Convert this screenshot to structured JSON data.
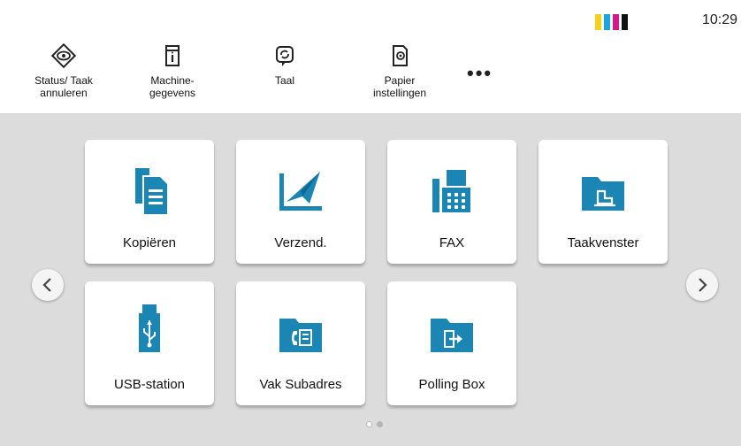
{
  "header": {
    "clock": "10:29",
    "toner_colors": [
      "#f2d21b",
      "#1aa6e0",
      "#d6198a",
      "#111111"
    ]
  },
  "quick_menu": {
    "items": [
      {
        "label": "Status/ Taak\nannuleren",
        "icon": "eye-diamond-icon"
      },
      {
        "label": "Machine-\ngegevens",
        "icon": "device-info-icon"
      },
      {
        "label": "Taal",
        "icon": "language-icon"
      },
      {
        "label": "Papier\ninstellingen",
        "icon": "paper-settings-icon"
      }
    ],
    "more_label": "•••"
  },
  "home": {
    "accent_color": "#1b86b4",
    "tiles": [
      {
        "label": "Kopiëren",
        "icon": "copy-icon"
      },
      {
        "label": "Verzend.",
        "icon": "send-icon"
      },
      {
        "label": "FAX",
        "icon": "fax-icon"
      },
      {
        "label": "Taakvenster",
        "icon": "job-box-folder-icon"
      },
      {
        "label": "USB-station",
        "icon": "usb-icon"
      },
      {
        "label": "Vak Subadres",
        "icon": "subaddress-box-folder-icon"
      },
      {
        "label": "Polling Box",
        "icon": "polling-box-folder-icon"
      }
    ],
    "page_indicator": {
      "current": 1,
      "total": 2
    }
  }
}
